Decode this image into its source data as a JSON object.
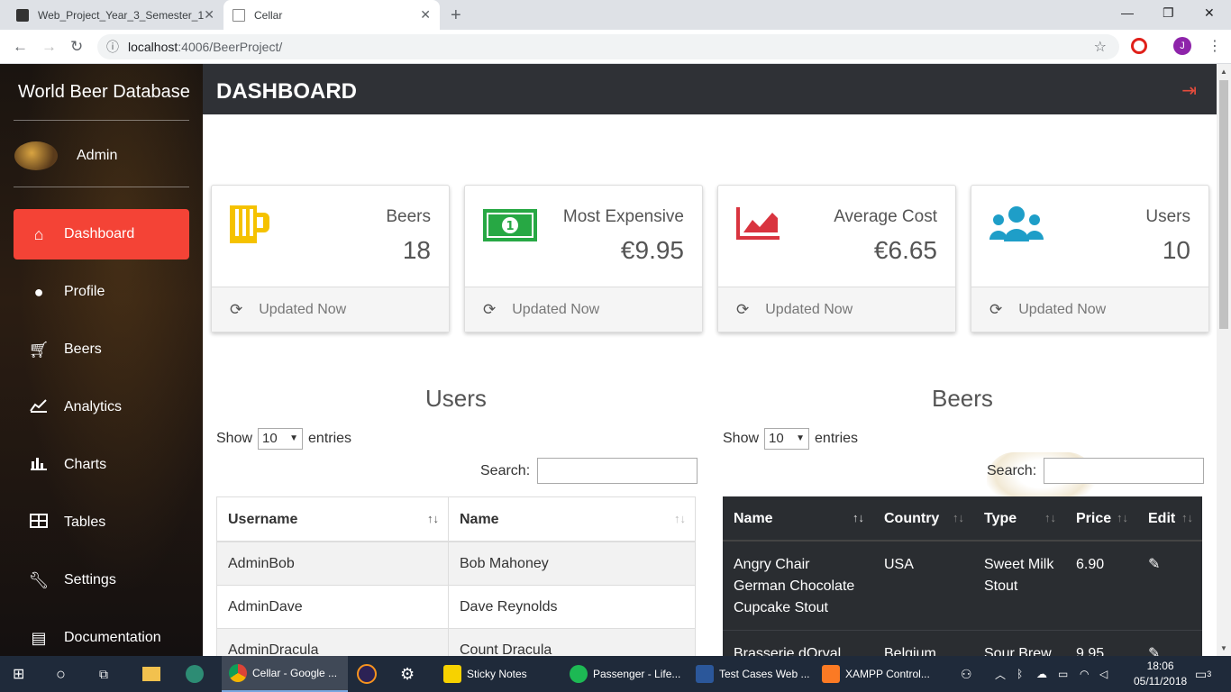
{
  "browser": {
    "tabs": [
      {
        "label": "Web_Project_Year_3_Semester_1"
      },
      {
        "label": "Cellar"
      }
    ],
    "url_host": "localhost",
    "url_rest": ":4006/BeerProject/",
    "profile_initial": "J"
  },
  "app": {
    "brand": "World Beer Database",
    "user": "Admin",
    "page_title": "DASHBOARD",
    "menu": [
      {
        "label": "Dashboard",
        "icon": "home-icon"
      },
      {
        "label": "Profile",
        "icon": "user-icon"
      },
      {
        "label": "Beers",
        "icon": "cart-icon"
      },
      {
        "label": "Analytics",
        "icon": "line-chart-icon"
      },
      {
        "label": "Charts",
        "icon": "bar-chart-icon"
      },
      {
        "label": "Tables",
        "icon": "table-icon"
      },
      {
        "label": "Settings",
        "icon": "wrench-icon"
      },
      {
        "label": "Documentation",
        "icon": "document-icon"
      }
    ],
    "cards": [
      {
        "label": "Beers",
        "value": "18",
        "footer": "Updated Now",
        "icon": "beer-icon",
        "color": "#f5c200"
      },
      {
        "label": "Most Expensive",
        "value": "€9.95",
        "footer": "Updated Now",
        "icon": "money-icon",
        "color": "#27a844"
      },
      {
        "label": "Average Cost",
        "value": "€6.65",
        "footer": "Updated Now",
        "icon": "area-chart-icon",
        "color": "#d9343f"
      },
      {
        "label": "Users",
        "value": "10",
        "footer": "Updated Now",
        "icon": "users-icon",
        "color": "#1e9ec8"
      }
    ],
    "users_section": {
      "title": "Users",
      "show": "Show",
      "entries_value": "10",
      "entries": "entries",
      "search": "Search:",
      "columns": [
        "Username",
        "Name"
      ],
      "rows": [
        [
          "AdminBob",
          "Bob Mahoney"
        ],
        [
          "AdminDave",
          "Dave Reynolds"
        ],
        [
          "AdminDracula",
          "Count Dracula"
        ]
      ]
    },
    "beers_section": {
      "title": "Beers",
      "show": "Show",
      "entries_value": "10",
      "entries": "entries",
      "search": "Search:",
      "columns": [
        "Name",
        "Country",
        "Type",
        "Price",
        "Edit"
      ],
      "rows": [
        {
          "name": "Angry Chair German Chocolate Cupcake Stout",
          "country": "USA",
          "type": "Sweet Milk Stout",
          "price": "6.90"
        },
        {
          "name": "Brasserie dOrval",
          "country": "Belgium",
          "type": "Sour Brew",
          "price": "9.95"
        }
      ]
    }
  },
  "taskbar": {
    "apps": [
      {
        "label": "Cellar - Google ...",
        "color": "#e8eaed"
      },
      {
        "label": "Sticky Notes",
        "color": "#f7d200"
      },
      {
        "label": "Passenger - Life...",
        "color": "#1db954"
      },
      {
        "label": "Test Cases Web ...",
        "color": "#2b579a"
      },
      {
        "label": "XAMPP Control...",
        "color": "#fb7a24"
      }
    ],
    "time": "18:06",
    "date": "05/11/2018",
    "notifications": "3"
  }
}
